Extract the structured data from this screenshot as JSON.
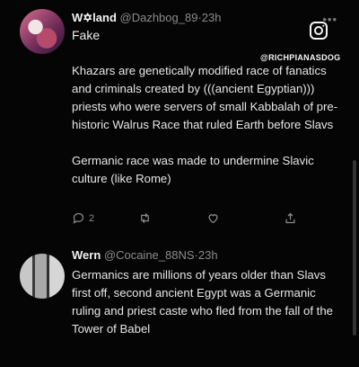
{
  "tweets": [
    {
      "display_name": "W✡land",
      "handle": "@Dazhbog_89",
      "separator": "·",
      "time": "23h",
      "reply_label": "Fake",
      "text": "Khazars are genetically modified race of fanatics and criminals created by (((ancient Egyptian))) priests who were servers of small Kabbalah of pre-historic Walrus Race that ruled Earth before Slavs\n\nGermanic race was made to undermine Slavic culture (like Rome)",
      "reply_count": "2"
    },
    {
      "display_name": "Wern",
      "handle": "@Cocaine_88NS",
      "separator": "·",
      "time": "23h",
      "text": "Germanics are millions of years older than Slavs first off, second ancient Egypt was a Germanic ruling and priest caste who fled from the fall of the Tower of Babel"
    }
  ],
  "watermark": "@RICHPIANASDOG",
  "icons": {
    "more": "more-icon",
    "reply": "reply-icon",
    "retweet": "retweet-icon",
    "like": "heart-icon",
    "share": "share-icon",
    "instagram": "instagram-icon"
  },
  "colors": {
    "background": "#050505",
    "text": "#e6e6e6",
    "muted": "#8a8a8a"
  }
}
